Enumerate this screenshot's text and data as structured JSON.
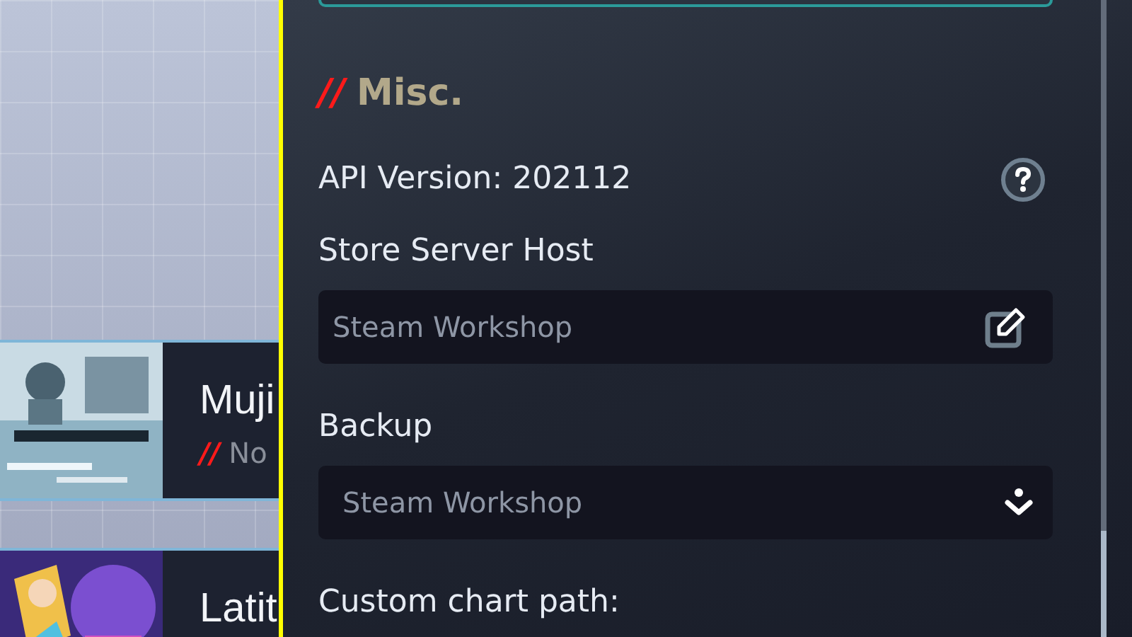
{
  "songs": [
    {
      "title": "Muji",
      "mark": "//",
      "subtitle": "No"
    },
    {
      "title": "Latit"
    }
  ],
  "section": {
    "mark": "//",
    "title": "Misc."
  },
  "api_version": "API Version: 202112",
  "fields": [
    {
      "kind": "text",
      "label": "Store Server Host",
      "value": "Steam Workshop"
    },
    {
      "kind": "dropdown",
      "label": "Backup",
      "value": "Steam Workshop"
    },
    {
      "kind": "none",
      "label": "Custom chart path:"
    }
  ]
}
